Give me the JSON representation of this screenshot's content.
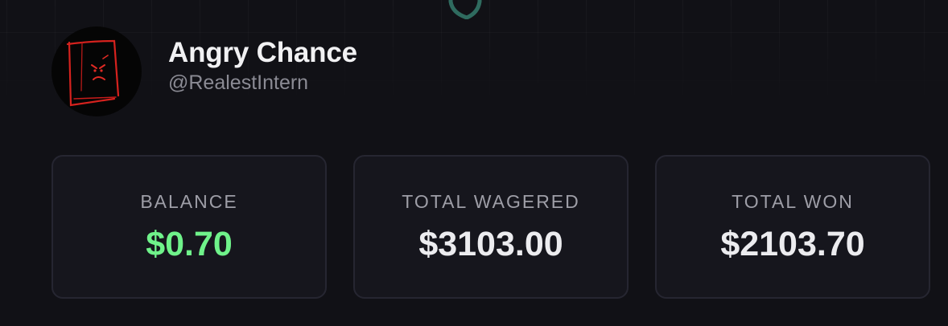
{
  "header": {
    "logo_icon": "shield-logo-icon"
  },
  "profile": {
    "display_name": "Angry Chance",
    "handle": "@RealestIntern",
    "avatar_icon": "angry-face-drawing-icon"
  },
  "stats": [
    {
      "label": "BALANCE",
      "value": "$0.70",
      "color": "#6ff28a"
    },
    {
      "label": "TOTAL WAGERED",
      "value": "$3103.00",
      "color": "#ececef"
    },
    {
      "label": "TOTAL WON",
      "value": "$2103.70",
      "color": "#ececef"
    }
  ],
  "theme": {
    "background": "#111116",
    "card_background": "#16161d",
    "card_border": "#262631",
    "accent_green": "#6ff28a",
    "logo_teal": "#2f6b5f"
  }
}
